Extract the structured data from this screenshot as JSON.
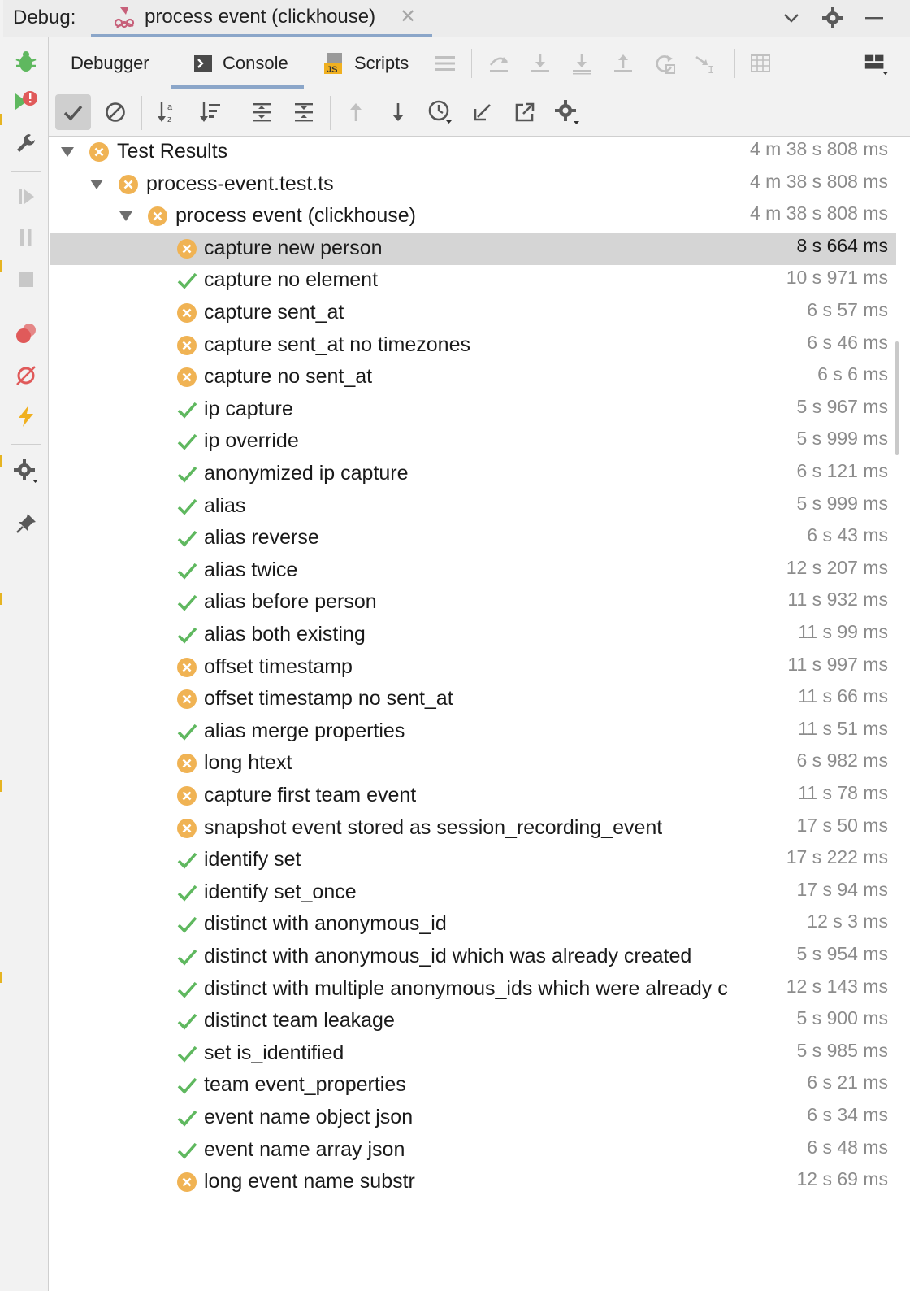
{
  "window": {
    "title_label": "Debug:",
    "run_tab_title": "process event (clickhouse)"
  },
  "tabs": [
    {
      "label": "Debugger"
    },
    {
      "label": "Console",
      "active": true
    },
    {
      "label": "Scripts"
    }
  ],
  "tree": {
    "root": {
      "label": "Test Results",
      "status": "failed",
      "time": "4 m 38 s 808 ms"
    },
    "file": {
      "label": "process-event.test.ts",
      "status": "failed",
      "time": "4 m 38 s 808 ms"
    },
    "suite": {
      "label": "process event (clickhouse)",
      "status": "failed",
      "time": "4 m 38 s 808 ms"
    },
    "tests": [
      {
        "label": "capture new person",
        "status": "failed",
        "time": "8 s 664 ms",
        "selected": true
      },
      {
        "label": "capture no element",
        "status": "passed",
        "time": "10 s 971 ms"
      },
      {
        "label": "capture sent_at",
        "status": "failed",
        "time": "6 s 57 ms"
      },
      {
        "label": "capture sent_at no timezones",
        "status": "failed",
        "time": "6 s 46 ms"
      },
      {
        "label": "capture no sent_at",
        "status": "failed",
        "time": "6 s 6 ms"
      },
      {
        "label": "ip capture",
        "status": "passed",
        "time": "5 s 967 ms"
      },
      {
        "label": "ip override",
        "status": "passed",
        "time": "5 s 999 ms"
      },
      {
        "label": "anonymized ip capture",
        "status": "passed",
        "time": "6 s 121 ms"
      },
      {
        "label": "alias",
        "status": "passed",
        "time": "5 s 999 ms"
      },
      {
        "label": "alias reverse",
        "status": "passed",
        "time": "6 s 43 ms"
      },
      {
        "label": "alias twice",
        "status": "passed",
        "time": "12 s 207 ms"
      },
      {
        "label": "alias before person",
        "status": "passed",
        "time": "11 s 932 ms"
      },
      {
        "label": "alias both existing",
        "status": "passed",
        "time": "11 s 99 ms"
      },
      {
        "label": "offset timestamp",
        "status": "failed",
        "time": "11 s 997 ms"
      },
      {
        "label": "offset timestamp no sent_at",
        "status": "failed",
        "time": "11 s 66 ms"
      },
      {
        "label": "alias merge properties",
        "status": "passed",
        "time": "11 s 51 ms"
      },
      {
        "label": "long htext",
        "status": "failed",
        "time": "6 s 982 ms"
      },
      {
        "label": "capture first team event",
        "status": "failed",
        "time": "11 s 78 ms"
      },
      {
        "label": "snapshot event stored as session_recording_event",
        "status": "failed",
        "time": "17 s 50 ms"
      },
      {
        "label": "identify set",
        "status": "passed",
        "time": "17 s 222 ms"
      },
      {
        "label": "identify set_once",
        "status": "passed",
        "time": "17 s 94 ms"
      },
      {
        "label": "distinct with anonymous_id",
        "status": "passed",
        "time": "12 s 3 ms"
      },
      {
        "label": "distinct with anonymous_id which was already created",
        "status": "passed",
        "time": "5 s 954 ms"
      },
      {
        "label": "distinct with multiple anonymous_ids which were already c",
        "status": "passed",
        "time": "12 s 143 ms"
      },
      {
        "label": "distinct team leakage",
        "status": "passed",
        "time": "5 s 900 ms"
      },
      {
        "label": "set is_identified",
        "status": "passed",
        "time": "5 s 985 ms"
      },
      {
        "label": "team event_properties",
        "status": "passed",
        "time": "6 s 21 ms"
      },
      {
        "label": "event name object json",
        "status": "passed",
        "time": "6 s 34 ms"
      },
      {
        "label": "event name array json",
        "status": "passed",
        "time": "6 s 48 ms"
      },
      {
        "label": "long event name substr",
        "status": "failed",
        "time": "12 s 69 ms"
      }
    ]
  },
  "colors": {
    "failed": "#f0b354",
    "passed": "#5fb85f",
    "selection": "#d5d5d5",
    "accent_underline": "#8ba6c9",
    "toolbar_bg": "#f2f2f2",
    "time_text": "#8c8c8c"
  },
  "icons": {
    "window_controls": [
      "chevron-down-icon",
      "gear-icon",
      "minimize-icon"
    ],
    "left_toolbar": [
      "bug-icon",
      "rerun-failed-icon",
      "wrench-icon",
      "resume-icon",
      "pause-icon",
      "stop-icon",
      "view-breakpoints-icon",
      "mute-breakpoints-icon",
      "lightning-icon",
      "settings-icon",
      "pin-icon"
    ],
    "tab_toolbar": [
      "list-icon",
      "step-over-icon",
      "step-into-icon",
      "force-step-into-icon",
      "step-out-icon",
      "run-to-cursor-icon",
      "evaluate-icon",
      "table-icon",
      "layout-icon"
    ],
    "test_toolbar": [
      "show-passed-icon",
      "show-ignored-icon",
      "sort-alpha-icon",
      "sort-duration-icon",
      "expand-all-icon",
      "collapse-all-icon",
      "prev-failed-icon",
      "next-failed-icon",
      "history-icon",
      "import-icon",
      "export-icon",
      "gear-icon"
    ]
  }
}
